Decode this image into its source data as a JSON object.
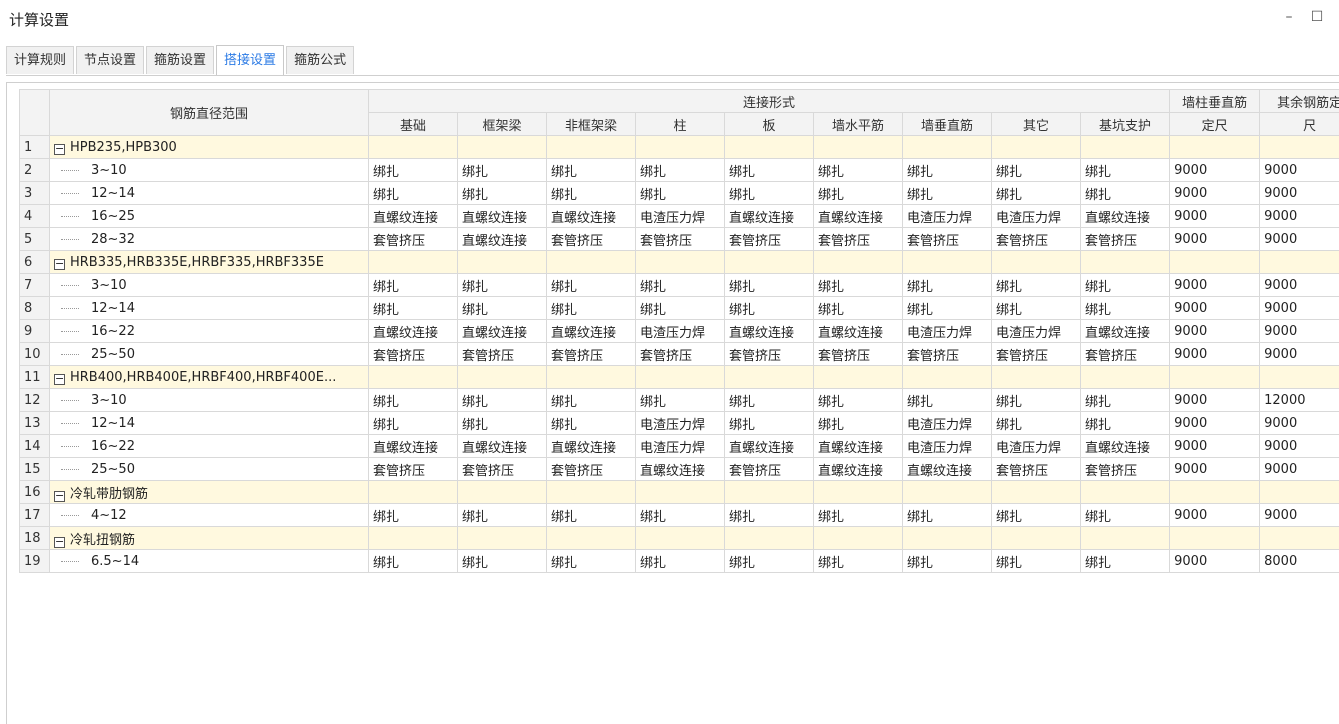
{
  "window": {
    "title": "计算设置",
    "minimize_glyph": "–",
    "maximize_glyph": "☐"
  },
  "tabs": [
    {
      "label": "计算规则",
      "active": false
    },
    {
      "label": "节点设置",
      "active": false
    },
    {
      "label": "箍筋设置",
      "active": false
    },
    {
      "label": "搭接设置",
      "active": true
    },
    {
      "label": "箍筋公式",
      "active": false
    }
  ],
  "table": {
    "header": {
      "diameter_range": "钢筋直径范围",
      "connection_form": "连接形式",
      "connection_columns": [
        "基础",
        "框架梁",
        "非框架梁",
        "柱",
        "板",
        "墙水平筋",
        "墙垂直筋",
        "其它",
        "基坑支护"
      ],
      "wall_col_fixed_1": "墙柱垂直筋",
      "wall_col_fixed_2": "定尺",
      "other_fixed_1": "其余钢筋定",
      "other_fixed_2": "尺"
    },
    "rows": [
      {
        "n": "1",
        "group": true,
        "label": "HPB235,HPB300"
      },
      {
        "n": "2",
        "group": false,
        "label": "3~10",
        "cells": [
          "绑扎",
          "绑扎",
          "绑扎",
          "绑扎",
          "绑扎",
          "绑扎",
          "绑扎",
          "绑扎",
          "绑扎",
          "9000",
          "9000"
        ]
      },
      {
        "n": "3",
        "group": false,
        "label": "12~14",
        "cells": [
          "绑扎",
          "绑扎",
          "绑扎",
          "绑扎",
          "绑扎",
          "绑扎",
          "绑扎",
          "绑扎",
          "绑扎",
          "9000",
          "9000"
        ]
      },
      {
        "n": "4",
        "group": false,
        "label": "16~25",
        "cells": [
          "直螺纹连接",
          "直螺纹连接",
          "直螺纹连接",
          "电渣压力焊",
          "直螺纹连接",
          "直螺纹连接",
          "电渣压力焊",
          "电渣压力焊",
          "直螺纹连接",
          "9000",
          "9000"
        ]
      },
      {
        "n": "5",
        "group": false,
        "label": "28~32",
        "cells": [
          "套管挤压",
          "直螺纹连接",
          "套管挤压",
          "套管挤压",
          "套管挤压",
          "套管挤压",
          "套管挤压",
          "套管挤压",
          "套管挤压",
          "9000",
          "9000"
        ]
      },
      {
        "n": "6",
        "group": true,
        "label": "HRB335,HRB335E,HRBF335,HRBF335E"
      },
      {
        "n": "7",
        "group": false,
        "label": "3~10",
        "cells": [
          "绑扎",
          "绑扎",
          "绑扎",
          "绑扎",
          "绑扎",
          "绑扎",
          "绑扎",
          "绑扎",
          "绑扎",
          "9000",
          "9000"
        ]
      },
      {
        "n": "8",
        "group": false,
        "label": "12~14",
        "cells": [
          "绑扎",
          "绑扎",
          "绑扎",
          "绑扎",
          "绑扎",
          "绑扎",
          "绑扎",
          "绑扎",
          "绑扎",
          "9000",
          "9000"
        ]
      },
      {
        "n": "9",
        "group": false,
        "label": "16~22",
        "cells": [
          "直螺纹连接",
          "直螺纹连接",
          "直螺纹连接",
          "电渣压力焊",
          "直螺纹连接",
          "直螺纹连接",
          "电渣压力焊",
          "电渣压力焊",
          "直螺纹连接",
          "9000",
          "9000"
        ]
      },
      {
        "n": "10",
        "group": false,
        "label": "25~50",
        "cells": [
          "套管挤压",
          "套管挤压",
          "套管挤压",
          "套管挤压",
          "套管挤压",
          "套管挤压",
          "套管挤压",
          "套管挤压",
          "套管挤压",
          "9000",
          "9000"
        ]
      },
      {
        "n": "11",
        "group": true,
        "label": "HRB400,HRB400E,HRBF400,HRBF400E..."
      },
      {
        "n": "12",
        "group": false,
        "label": "3~10",
        "cells": [
          "绑扎",
          "绑扎",
          "绑扎",
          "绑扎",
          "绑扎",
          "绑扎",
          "绑扎",
          "绑扎",
          "绑扎",
          "9000",
          "12000"
        ]
      },
      {
        "n": "13",
        "group": false,
        "label": "12~14",
        "cells": [
          "绑扎",
          "绑扎",
          "绑扎",
          "电渣压力焊",
          "绑扎",
          "绑扎",
          "电渣压力焊",
          "绑扎",
          "绑扎",
          "9000",
          "9000"
        ]
      },
      {
        "n": "14",
        "group": false,
        "label": "16~22",
        "cells": [
          "直螺纹连接",
          "直螺纹连接",
          "直螺纹连接",
          "电渣压力焊",
          "直螺纹连接",
          "直螺纹连接",
          "电渣压力焊",
          "电渣压力焊",
          "直螺纹连接",
          "9000",
          "9000"
        ]
      },
      {
        "n": "15",
        "group": false,
        "label": "25~50",
        "cells": [
          "套管挤压",
          "套管挤压",
          "套管挤压",
          "直螺纹连接",
          "套管挤压",
          "直螺纹连接",
          "直螺纹连接",
          "套管挤压",
          "套管挤压",
          "9000",
          "9000"
        ]
      },
      {
        "n": "16",
        "group": true,
        "label": "冷轧带肋钢筋"
      },
      {
        "n": "17",
        "group": false,
        "label": "4~12",
        "cells": [
          "绑扎",
          "绑扎",
          "绑扎",
          "绑扎",
          "绑扎",
          "绑扎",
          "绑扎",
          "绑扎",
          "绑扎",
          "9000",
          "9000"
        ]
      },
      {
        "n": "18",
        "group": true,
        "label": "冷轧扭钢筋"
      },
      {
        "n": "19",
        "group": false,
        "label": "6.5~14",
        "cells": [
          "绑扎",
          "绑扎",
          "绑扎",
          "绑扎",
          "绑扎",
          "绑扎",
          "绑扎",
          "绑扎",
          "绑扎",
          "9000",
          "8000"
        ]
      }
    ]
  }
}
